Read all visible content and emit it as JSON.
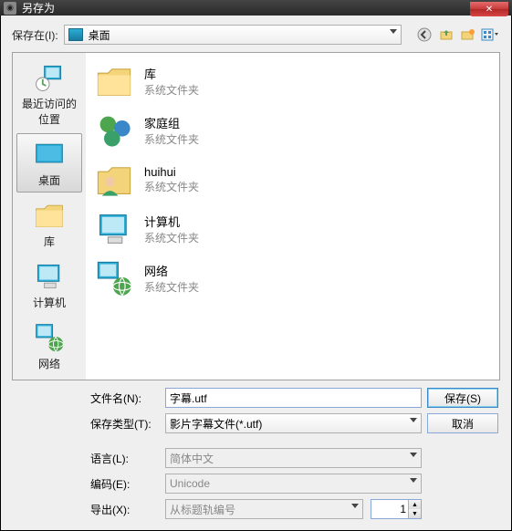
{
  "title": "另存为",
  "toolbar": {
    "save_in_label": "保存在(I):",
    "location_value": "桌面"
  },
  "places": [
    {
      "label": "最近访问的位置",
      "icon": "recent"
    },
    {
      "label": "桌面",
      "icon": "desktop"
    },
    {
      "label": "库",
      "icon": "libraries"
    },
    {
      "label": "计算机",
      "icon": "computer"
    },
    {
      "label": "网络",
      "icon": "network"
    }
  ],
  "selected_place_index": 1,
  "files": [
    {
      "name": "库",
      "type": "系统文件夹",
      "icon": "libraries"
    },
    {
      "name": "家庭组",
      "type": "系统文件夹",
      "icon": "homegroup"
    },
    {
      "name": "huihui",
      "type": "系统文件夹",
      "icon": "user"
    },
    {
      "name": "计算机",
      "type": "系统文件夹",
      "icon": "computer"
    },
    {
      "name": "网络",
      "type": "系统文件夹",
      "icon": "network"
    }
  ],
  "form": {
    "filename_label": "文件名(N):",
    "filename_value": "字幕.utf",
    "savetype_label": "保存类型(T):",
    "savetype_value": "影片字幕文件(*.utf)",
    "language_label": "语言(L):",
    "language_value": "简体中文",
    "encoding_label": "编码(E):",
    "encoding_value": "Unicode",
    "export_label": "导出(X):",
    "export_value": "从标题轨编号",
    "export_number": "1",
    "save_btn": "保存(S)",
    "cancel_btn": "取消"
  }
}
